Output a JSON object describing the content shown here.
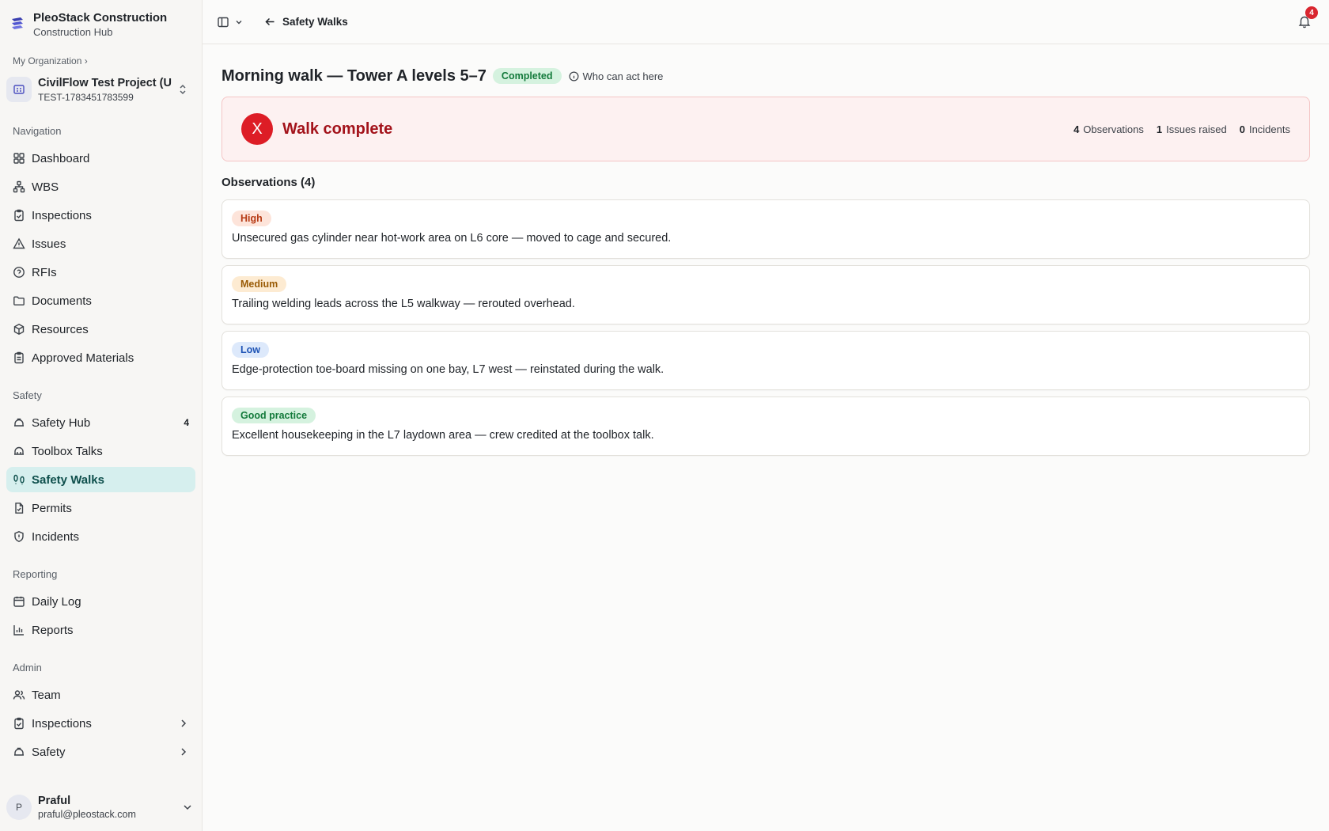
{
  "brand": {
    "name": "PleoStack Construction",
    "subtitle": "Construction Hub"
  },
  "org": {
    "label": "My Organization ›"
  },
  "project": {
    "name": "CivilFlow Test Project (U...",
    "code": "TEST-1783451783599"
  },
  "nav_sections": {
    "navigation": "Navigation",
    "safety": "Safety",
    "reporting": "Reporting",
    "admin": "Admin"
  },
  "nav": {
    "dashboard": "Dashboard",
    "wbs": "WBS",
    "inspections": "Inspections",
    "issues": "Issues",
    "rfis": "RFIs",
    "documents": "Documents",
    "resources": "Resources",
    "approved_materials": "Approved Materials",
    "safety_hub": "Safety Hub",
    "safety_hub_count": "4",
    "toolbox_talks": "Toolbox Talks",
    "safety_walks": "Safety Walks",
    "permits": "Permits",
    "incidents": "Incidents",
    "daily_log": "Daily Log",
    "reports": "Reports",
    "team": "Team",
    "admin_inspections": "Inspections",
    "admin_safety": "Safety"
  },
  "user": {
    "initial": "P",
    "name": "Praful",
    "email": "praful@pleostack.com"
  },
  "topbar": {
    "back_label": "Safety Walks",
    "notifications_count": "4"
  },
  "page": {
    "title": "Morning walk — Tower A levels 5–7",
    "status": "Completed",
    "who_can_act": "Who can act here"
  },
  "banner": {
    "icon_letter": "X",
    "title": "Walk complete",
    "observations_count": "4",
    "observations_label": "Observations",
    "issues_count": "1",
    "issues_label": "Issues raised",
    "incidents_count": "0",
    "incidents_label": "Incidents"
  },
  "observations": {
    "heading": "Observations (4)",
    "items": [
      {
        "severity": "High",
        "text": "Unsecured gas cylinder near hot-work area on L6 core — moved to cage and secured."
      },
      {
        "severity": "Medium",
        "text": "Trailing welding leads across the L5 walkway — rerouted overhead."
      },
      {
        "severity": "Low",
        "text": "Edge-protection toe-board missing on one bay, L7 west — reinstated during the walk."
      },
      {
        "severity": "Good practice",
        "text": "Excellent housekeeping in the L7 laydown area — crew credited at the toolbox talk."
      }
    ]
  },
  "colors": {
    "accent_active_bg": "#d6efee",
    "danger": "#dd1d26",
    "success_bg": "#d5f2df",
    "success_text": "#137a3b"
  }
}
